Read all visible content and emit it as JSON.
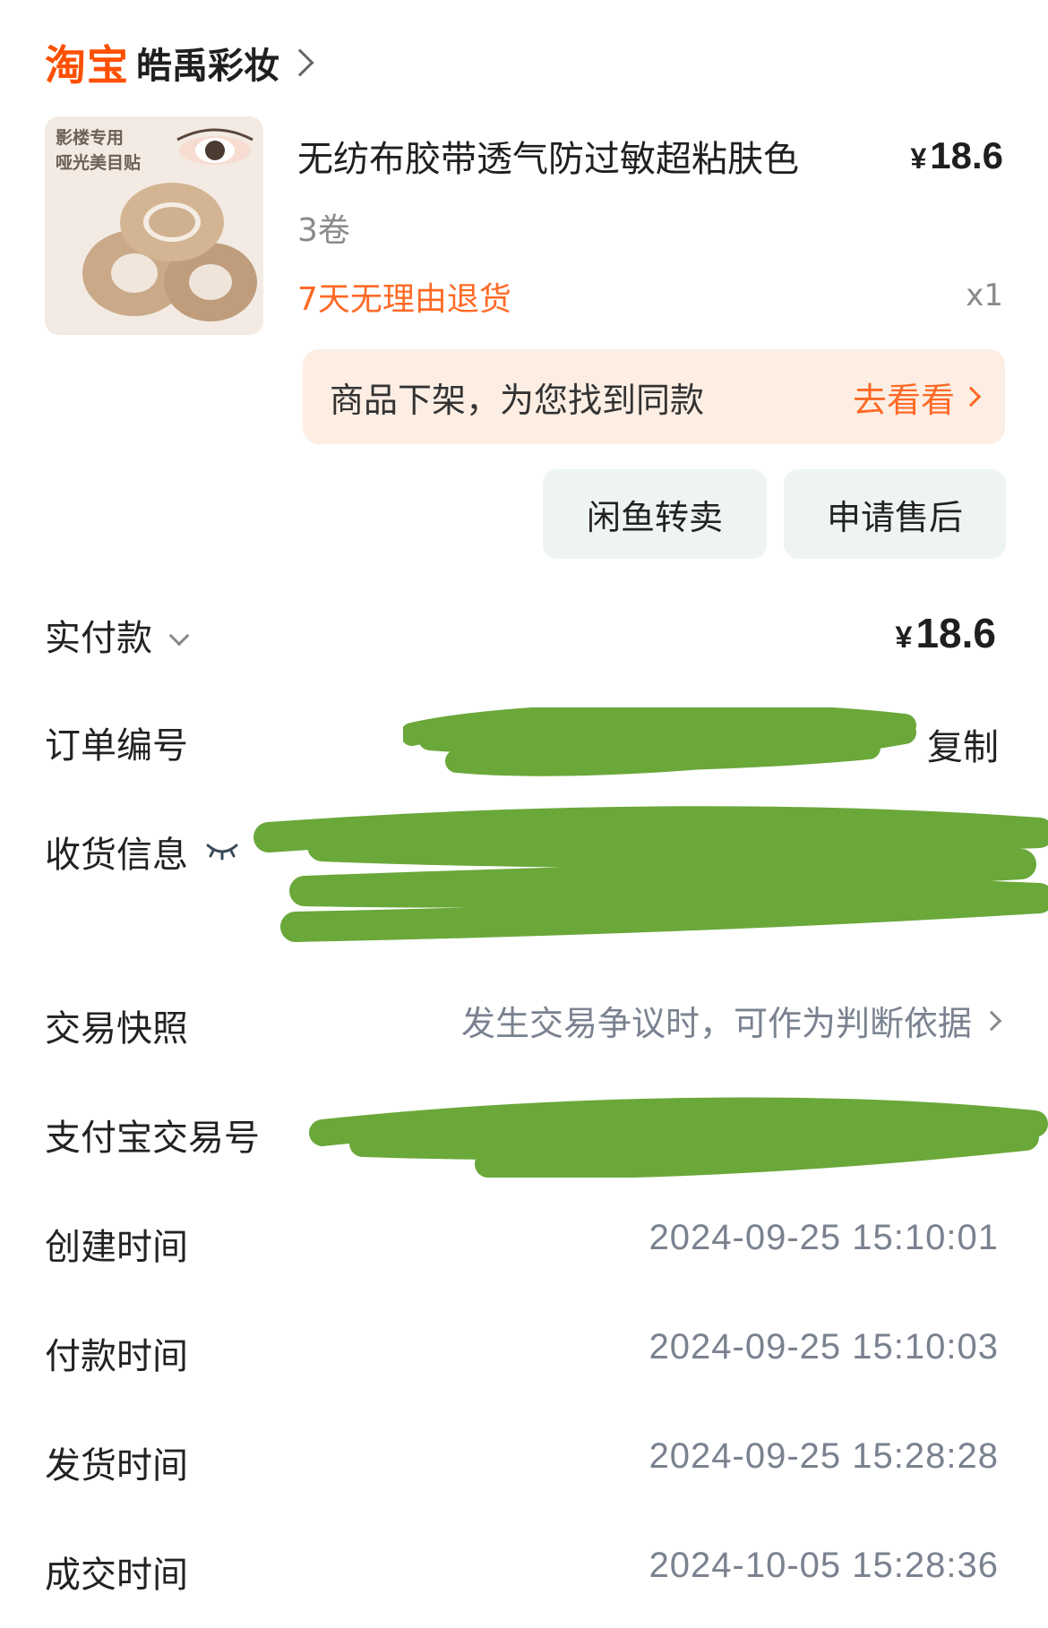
{
  "header": {
    "platform_logo": "淘宝",
    "shop_name": "皓禹彩妆"
  },
  "product": {
    "image_caption": [
      "影楼专用",
      "哑光美目贴"
    ],
    "title": "无纺布胶带透气防过敏超粘肤色",
    "price_symbol": "¥",
    "price": "18.6",
    "variant": "3卷",
    "return_policy": "7天无理由退货",
    "quantity": "x1"
  },
  "delisted_banner": {
    "text": "商品下架，为您找到同款",
    "link_label": "去看看"
  },
  "actions": {
    "resell_label": "闲鱼转卖",
    "after_sale_label": "申请售后"
  },
  "order": {
    "paid_label": "实付款",
    "paid_symbol": "¥",
    "paid_amount": "18.6",
    "order_number_label": "订单编号",
    "copy_label": "复制",
    "shipping_label": "收货信息",
    "snapshot_label": "交易快照",
    "snapshot_hint": "发生交易争议时，可作为判断依据",
    "alipay_label": "支付宝交易号",
    "created_label": "创建时间",
    "created_time": "2024-09-25 15:10:01",
    "paid_time_label": "付款时间",
    "paid_time": "2024-09-25 15:10:03",
    "shipped_label": "发货时间",
    "shipped_time": "2024-09-25 15:28:28",
    "completed_label": "成交时间",
    "completed_time": "2024-10-05 15:28:36"
  },
  "colors": {
    "brand_orange": "#ff5000",
    "redaction_green": "#6aa83a",
    "banner_bg": "#fdeee4"
  }
}
